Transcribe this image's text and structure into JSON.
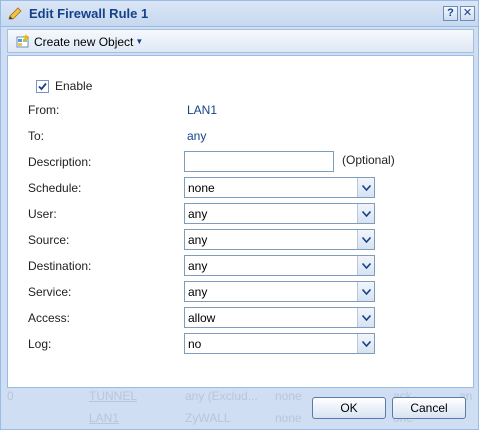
{
  "window": {
    "title": "Edit Firewall Rule 1",
    "help_label": "?",
    "close_label": "✕"
  },
  "toolbar": {
    "create_label": "Create new Object"
  },
  "form": {
    "enable_label": "Enable",
    "enable_checked": true,
    "from_label": "From:",
    "from_value": "LAN1",
    "to_label": "To:",
    "to_value": "any",
    "description_label": "Description:",
    "description_value": "",
    "description_hint": "(Optional)",
    "schedule_label": "Schedule:",
    "schedule_value": "none",
    "user_label": "User:",
    "user_value": "any",
    "source_label": "Source:",
    "source_value": "any",
    "destination_label": "Destination:",
    "destination_value": "any",
    "service_label": "Service:",
    "service_value": "any",
    "access_label": "Access:",
    "access_value": "allow",
    "log_label": "Log:",
    "log_value": "no"
  },
  "background_rows": [
    [
      "0",
      "TUNNEL",
      "any (Exclud...",
      "none",
      "ack",
      "an"
    ],
    [
      "",
      "LAN1",
      "ZyWALL",
      "none",
      "one",
      ""
    ]
  ],
  "buttons": {
    "ok_label": "OK",
    "cancel_label": "Cancel"
  },
  "colors": {
    "title_text": "#15428b",
    "link_value": "#15428b",
    "window_frame": "#99bbe8"
  }
}
